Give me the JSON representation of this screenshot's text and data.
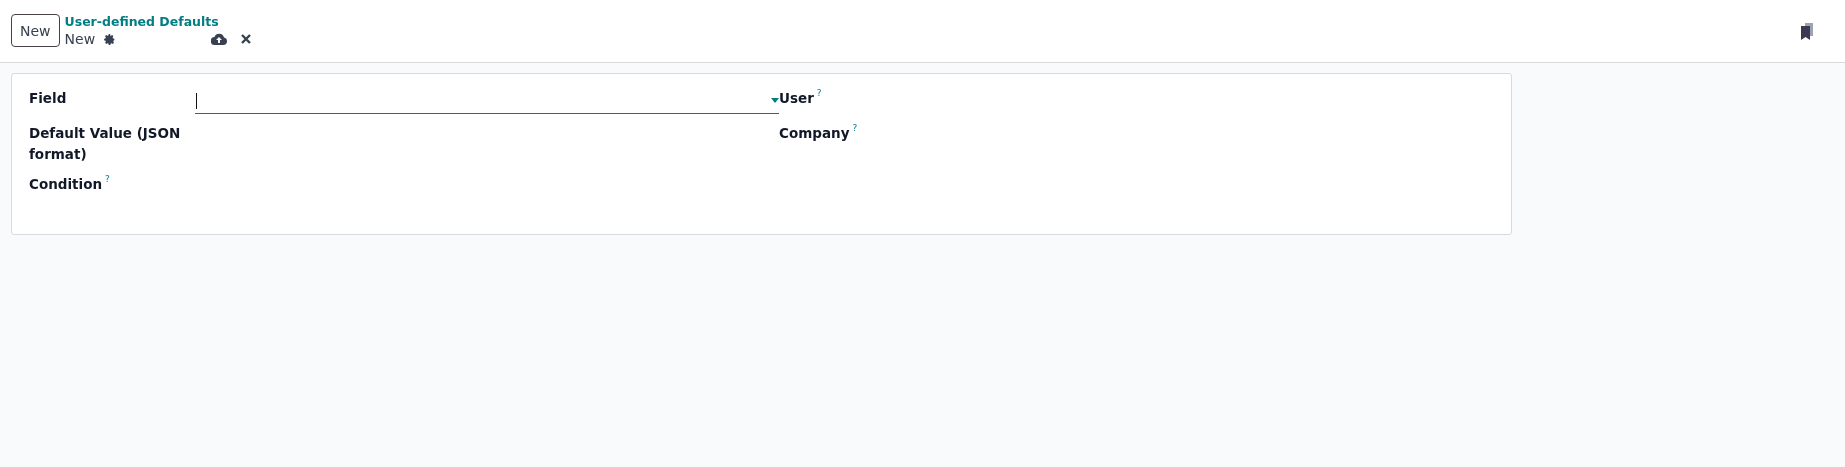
{
  "control_panel": {
    "new_button": "New",
    "breadcrumb": "User-defined Defaults",
    "record_name": "New"
  },
  "form": {
    "left": [
      {
        "label": "Field",
        "dropdown": true,
        "help": false
      },
      {
        "label": "Default Value (JSON format)",
        "dropdown": false,
        "help": false
      },
      {
        "label": "Condition",
        "dropdown": false,
        "help": true
      }
    ],
    "right": [
      {
        "label": "User",
        "dropdown": false,
        "help": true
      },
      {
        "label": "Company",
        "dropdown": false,
        "help": true
      }
    ],
    "help_mark": "?"
  }
}
